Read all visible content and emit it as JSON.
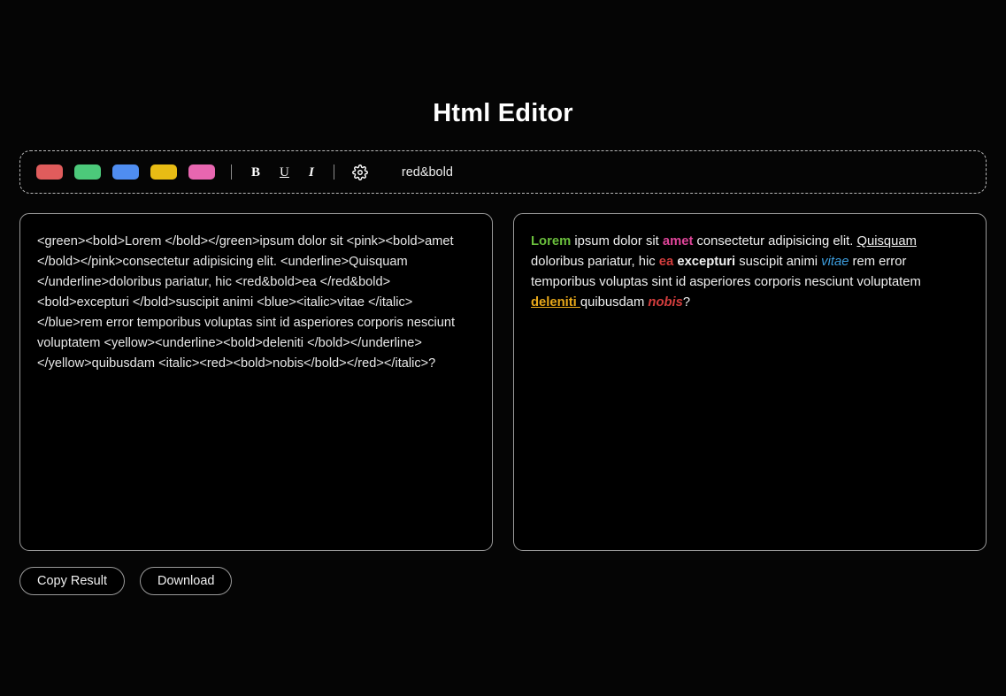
{
  "app": {
    "title": "Html Editor",
    "background_color": "#000000"
  },
  "toolbar": {
    "colors": [
      {
        "name": "red",
        "hex": "#e05c5c"
      },
      {
        "name": "green",
        "hex": "#4cc97a"
      },
      {
        "name": "blue",
        "hex": "#4f8df0"
      },
      {
        "name": "yellow",
        "hex": "#e8bc14"
      },
      {
        "name": "pink",
        "hex": "#e866b0"
      }
    ],
    "format_buttons": [
      {
        "name": "bold",
        "label": "B"
      },
      {
        "name": "underline",
        "label": "U"
      },
      {
        "name": "italic",
        "label": "I"
      }
    ],
    "settings_icon": "gear-icon",
    "preset_label": "red&bold",
    "divider_glyph": "|"
  },
  "editor": {
    "source": "<green><bold>Lorem </bold></green>ipsum dolor sit <pink><bold>amet </bold></pink>consectetur adipisicing elit. <underline>Quisquam </underline>doloribus pariatur, hic <red&bold>ea </red&bold><bold>excepturi </bold>suscipit animi <blue><italic>vitae </italic></blue>rem error temporibus voluptas sint id asperiores corporis nesciunt voluptatem <yellow><underline><bold>deleniti </bold></underline></yellow>quibusdam <italic><red><bold>nobis</bold></red></italic>?"
  },
  "preview": {
    "segments": [
      {
        "text": "Lorem ",
        "color": "#6abf3c",
        "bold": true,
        "italic": false,
        "underline": false
      },
      {
        "text": "ipsum dolor sit ",
        "color": "#f0f0f0",
        "bold": false,
        "italic": false,
        "underline": false
      },
      {
        "text": "amet ",
        "color": "#e0459a",
        "bold": true,
        "italic": false,
        "underline": false
      },
      {
        "text": "consectetur adipisicing elit. ",
        "color": "#f0f0f0",
        "bold": false,
        "italic": false,
        "underline": false
      },
      {
        "text": "Quisquam ",
        "color": "#f0f0f0",
        "bold": false,
        "italic": false,
        "underline": true
      },
      {
        "text": "doloribus pariatur, hic ",
        "color": "#f0f0f0",
        "bold": false,
        "italic": false,
        "underline": false
      },
      {
        "text": "ea ",
        "color": "#d23d3d",
        "bold": true,
        "italic": false,
        "underline": false
      },
      {
        "text": "excepturi ",
        "color": "#f0f0f0",
        "bold": true,
        "italic": false,
        "underline": false
      },
      {
        "text": "suscipit animi ",
        "color": "#f0f0f0",
        "bold": false,
        "italic": false,
        "underline": false
      },
      {
        "text": "vitae ",
        "color": "#3d9fe0",
        "bold": false,
        "italic": true,
        "underline": false
      },
      {
        "text": "rem error temporibus voluptas sint id asperiores corporis nesciunt voluptatem ",
        "color": "#f0f0f0",
        "bold": false,
        "italic": false,
        "underline": false
      },
      {
        "text": "deleniti ",
        "color": "#e8a81a",
        "bold": true,
        "italic": false,
        "underline": true
      },
      {
        "text": "quibusdam ",
        "color": "#f0f0f0",
        "bold": false,
        "italic": false,
        "underline": false
      },
      {
        "text": "nobis",
        "color": "#d23d3d",
        "bold": true,
        "italic": true,
        "underline": false
      },
      {
        "text": "?",
        "color": "#f0f0f0",
        "bold": false,
        "italic": false,
        "underline": false
      }
    ]
  },
  "actions": {
    "copy_label": "Copy Result",
    "download_label": "Download"
  }
}
